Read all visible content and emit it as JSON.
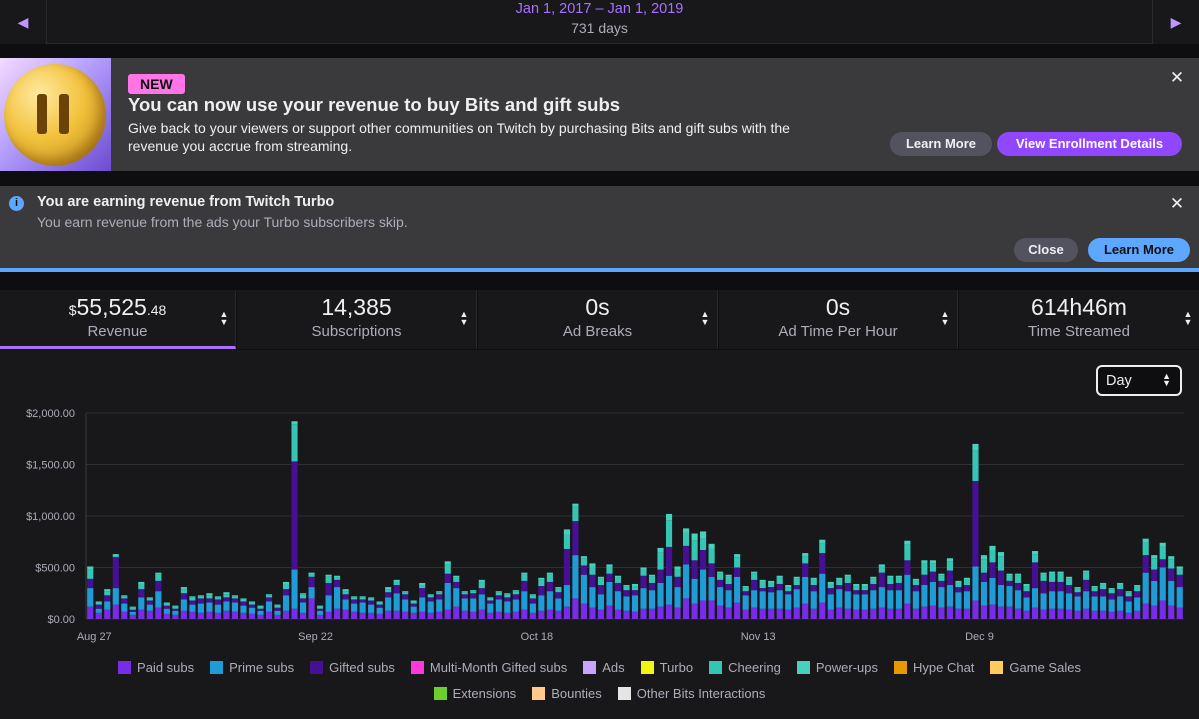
{
  "date_bar": {
    "range": "Jan 1, 2017 – Jan 1, 2019",
    "days": "731 days",
    "prev_icon": "chevron-left-icon",
    "next_icon": "chevron-right-icon"
  },
  "promo_banner": {
    "badge": "NEW",
    "title": "You can now use your revenue to buy Bits and gift subs",
    "body": "Give back to your viewers or support other communities on Twitch by purchasing Bits and gift subs with the revenue you accrue from streaming.",
    "learn_more": "Learn More",
    "view_details": "View Enrollment Details",
    "close_icon": "close-icon"
  },
  "info_banner": {
    "icon": "info-icon",
    "title": "You are earning revenue from Twitch Turbo",
    "body": "You earn revenue from the ads your Turbo subscribers skip.",
    "close_label": "Close",
    "learn_more": "Learn More",
    "close_icon": "close-icon"
  },
  "stats": [
    {
      "currency": "$",
      "value": "55,525",
      "decimals": ".48",
      "label": "Revenue",
      "active": true
    },
    {
      "value": "14,385",
      "label": "Subscriptions"
    },
    {
      "value": "0s",
      "label": "Ad Breaks"
    },
    {
      "value": "0s",
      "label": "Ad Time Per Hour"
    },
    {
      "value": "614h46m",
      "label": "Time Streamed"
    }
  ],
  "granularity_select": {
    "value": "Day"
  },
  "colors": {
    "accent": "#a970ff",
    "paid_subs": "#772ce8",
    "prime_subs": "#1f9bd8",
    "gifted_subs": "#451093",
    "multi_month": "#ff38db",
    "ads": "#c7a4ff",
    "turbo": "#eff511",
    "cheering": "#34c5b4",
    "power_ups": "#45d1ba",
    "hype_chat": "#e69900",
    "game_sales": "#ffca5f",
    "extensions": "#57bee6",
    "bounties": "#ffd38a",
    "other_bits": "#e5e5e5"
  },
  "legend": [
    {
      "label": "Paid subs",
      "color": "#772ce8"
    },
    {
      "label": "Prime subs",
      "color": "#1f9bd8"
    },
    {
      "label": "Gifted subs",
      "color": "#451093"
    },
    {
      "label": "Multi-Month Gifted subs",
      "color": "#ff38db"
    },
    {
      "label": "Ads",
      "color": "#c7a4ff"
    },
    {
      "label": "Turbo",
      "color": "#eff511"
    },
    {
      "label": "Cheering",
      "color": "#34c5b4"
    },
    {
      "label": "Power-ups",
      "color": "#45d1ba"
    },
    {
      "label": "Hype Chat",
      "color": "#e69900"
    },
    {
      "label": "Game Sales",
      "color": "#ffca5f"
    },
    {
      "label": "Extensions",
      "color": "#6ccf2e"
    },
    {
      "label": "Bounties",
      "color": "#ffca8a"
    },
    {
      "label": "Other Bits Interactions",
      "color": "#e5e5e5"
    }
  ],
  "chart_data": {
    "type": "bar",
    "stacked": true,
    "ylim": [
      0,
      2000
    ],
    "yticks": [
      "$0.00",
      "$500.00",
      "$1,000.00",
      "$1,500.00",
      "$2,000.00"
    ],
    "ytick_values": [
      0,
      500,
      1000,
      1500,
      2000
    ],
    "xticks": [
      {
        "label": "Aug 27",
        "index": 0
      },
      {
        "label": "Sep 22",
        "index": 26
      },
      {
        "label": "Oct 18",
        "index": 52
      },
      {
        "label": "Nov 13",
        "index": 78
      },
      {
        "label": "Dec 9",
        "index": 104
      }
    ],
    "grid": true,
    "series": [
      {
        "name": "Paid subs",
        "values": [
          120,
          60,
          90,
          140,
          70,
          40,
          90,
          80,
          110,
          50,
          40,
          80,
          70,
          60,
          70,
          60,
          80,
          70,
          60,
          50,
          40,
          70,
          40,
          80,
          100,
          60,
          200,
          40,
          70,
          100,
          90,
          70,
          60,
          60,
          50,
          80,
          80,
          70,
          60,
          70,
          60,
          70,
          90,
          120,
          80,
          70,
          90,
          60,
          70,
          60,
          70,
          90,
          60,
          80,
          90,
          80,
          120,
          200,
          150,
          110,
          90,
          130,
          90,
          80,
          70,
          100,
          100,
          120,
          140,
          110,
          200,
          150,
          180,
          180,
          130,
          110,
          160,
          90,
          110,
          100,
          100,
          100,
          90,
          110,
          150,
          100,
          160,
          90,
          110,
          100,
          90,
          90,
          100,
          110,
          100,
          100,
          150,
          100,
          120,
          130,
          110,
          120,
          100,
          100,
          180,
          130,
          140,
          120,
          120,
          100,
          80,
          110,
          90,
          100,
          100,
          90,
          80,
          100,
          80,
          80,
          70,
          80,
          60,
          80,
          150,
          130,
          180,
          130,
          110
        ]
      },
      {
        "name": "Prime subs",
        "values": [
          180,
          40,
          80,
          160,
          80,
          30,
          120,
          60,
          160,
          50,
          40,
          110,
          70,
          90,
          90,
          80,
          90,
          90,
          70,
          60,
          40,
          100,
          40,
          150,
          380,
          100,
          110,
          40,
          160,
          210,
          100,
          80,
          100,
          80,
          60,
          130,
          170,
          120,
          60,
          140,
          110,
          120,
          260,
          180,
          120,
          130,
          150,
          90,
          120,
          110,
          120,
          180,
          90,
          150,
          180,
          120,
          210,
          420,
          280,
          200,
          150,
          230,
          180,
          140,
          160,
          200,
          180,
          230,
          280,
          200,
          330,
          240,
          300,
          230,
          180,
          170,
          250,
          140,
          170,
          170,
          160,
          180,
          150,
          180,
          260,
          170,
          280,
          150,
          180,
          170,
          150,
          150,
          180,
          200,
          180,
          180,
          280,
          170,
          210,
          230,
          200,
          210,
          160,
          170,
          330,
          230,
          260,
          210,
          200,
          180,
          130,
          190,
          160,
          170,
          170,
          160,
          140,
          170,
          140,
          140,
          120,
          140,
          110,
          130,
          300,
          240,
          320,
          240,
          200
        ]
      },
      {
        "name": "Gifted subs",
        "values": [
          90,
          40,
          60,
          300,
          50,
          20,
          80,
          40,
          100,
          30,
          20,
          60,
          40,
          50,
          40,
          50,
          40,
          40,
          40,
          30,
          20,
          40,
          30,
          60,
          1050,
          40,
          100,
          20,
          120,
          70,
          50,
          40,
          30,
          40,
          30,
          50,
          80,
          50,
          30,
          90,
          40,
          50,
          90,
          60,
          40,
          50,
          60,
          30,
          40,
          40,
          50,
          100,
          50,
          90,
          90,
          60,
          350,
          330,
          90,
          120,
          90,
          80,
          80,
          60,
          50,
          120,
          70,
          130,
          280,
          100,
          180,
          180,
          190,
          130,
          70,
          60,
          90,
          40,
          100,
          30,
          50,
          60,
          30,
          40,
          130,
          60,
          200,
          60,
          40,
          80,
          40,
          40,
          60,
          140,
          60,
          70,
          140,
          60,
          100,
          100,
          60,
          140,
          50,
          60,
          830,
          90,
          150,
          140,
          50,
          70,
          60,
          250,
          120,
          90,
          90,
          80,
          40,
          110,
          50,
          70,
          60,
          70,
          50,
          60,
          170,
          110,
          80,
          120,
          120
        ]
      },
      {
        "name": "Cheering",
        "values": [
          90,
          20,
          40,
          10,
          20,
          20,
          50,
          20,
          60,
          20,
          20,
          40,
          30,
          20,
          30,
          20,
          30,
          20,
          20,
          20,
          20,
          20,
          20,
          50,
          360,
          40,
          20,
          20,
          60,
          20,
          30,
          20,
          20,
          20,
          20,
          30,
          30,
          20,
          20,
          30,
          20,
          20,
          90,
          40,
          20,
          20,
          60,
          20,
          30,
          30,
          30,
          60,
          30,
          60,
          70,
          40,
          140,
          140,
          70,
          80,
          60,
          70,
          50,
          40,
          40,
          60,
          60,
          170,
          260,
          70,
          130,
          190,
          110,
          140,
          60,
          70,
          100,
          40,
          60,
          60,
          40,
          60,
          40,
          60,
          70,
          50,
          90,
          40,
          50,
          60,
          40,
          40,
          50,
          60,
          60,
          50,
          150,
          40,
          110,
          80,
          50,
          90,
          40,
          50,
          300,
          130,
          120,
          140,
          50,
          70,
          50,
          80,
          60,
          80,
          80,
          60,
          40,
          70,
          40,
          50,
          40,
          50,
          40,
          50,
          120,
          110,
          120,
          90,
          60
        ]
      },
      {
        "name": "Power-ups",
        "values": [
          30,
          10,
          20,
          20,
          10,
          10,
          20,
          10,
          20,
          10,
          10,
          20,
          10,
          10,
          20,
          10,
          20,
          10,
          10,
          10,
          10,
          10,
          10,
          20,
          30,
          10,
          20,
          10,
          20,
          20,
          20,
          10,
          10,
          10,
          10,
          20,
          20,
          10,
          10,
          20,
          10,
          10,
          30,
          20,
          10,
          10,
          20,
          10,
          10,
          10,
          10,
          20,
          10,
          20,
          20,
          10,
          50,
          30,
          20,
          30,
          20,
          20,
          20,
          10,
          20,
          20,
          20,
          40,
          60,
          30,
          40,
          70,
          70,
          50,
          20,
          20,
          30,
          10,
          20,
          20,
          20,
          20,
          20,
          20,
          30,
          20,
          40,
          20,
          20,
          20,
          20,
          20,
          20,
          20,
          20,
          20,
          40,
          20,
          30,
          30,
          20,
          30,
          20,
          20,
          60,
          40,
          40,
          40,
          20,
          20,
          20,
          30,
          20,
          20,
          20,
          20,
          10,
          20,
          10,
          10,
          10,
          10,
          10,
          10,
          40,
          30,
          40,
          30,
          20
        ]
      }
    ]
  }
}
